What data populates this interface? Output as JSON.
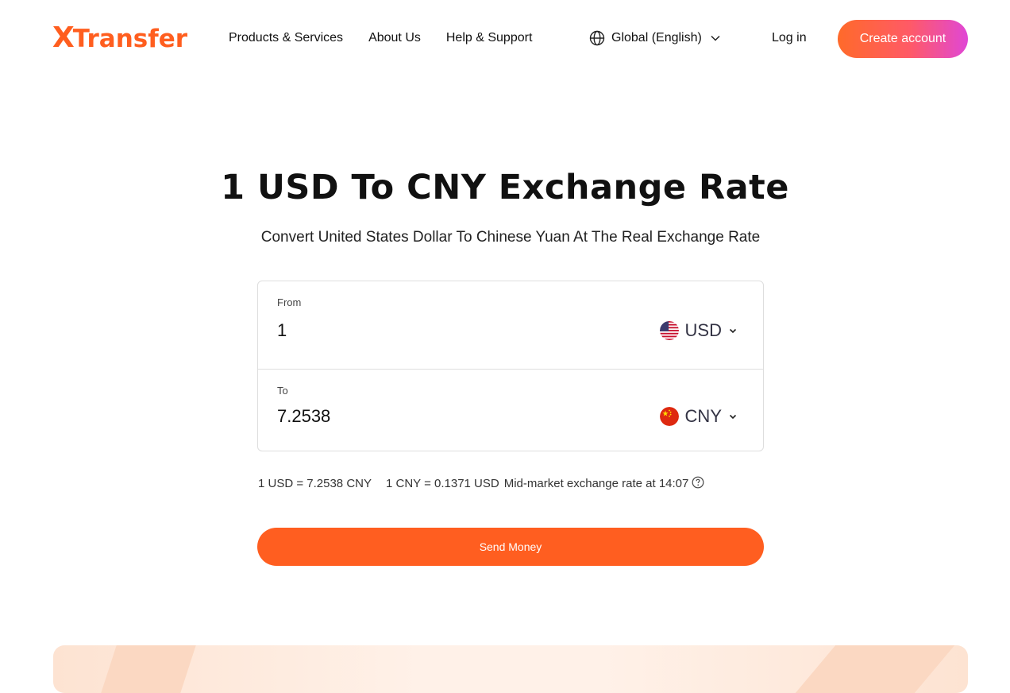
{
  "header": {
    "logo_text": "XTransfer",
    "nav": [
      {
        "label": "Products & Services"
      },
      {
        "label": "About Us"
      },
      {
        "label": "Help & Support"
      }
    ],
    "language_label": "Global (English)",
    "login_label": "Log in",
    "create_account_label": "Create account"
  },
  "hero": {
    "title": "1 USD To CNY Exchange Rate",
    "subtitle": "Convert United States Dollar To Chinese Yuan At The Real Exchange Rate"
  },
  "converter": {
    "from": {
      "label": "From",
      "amount": "1",
      "currency": "USD",
      "flag_icon": "us-flag-icon"
    },
    "to": {
      "label": "To",
      "amount": "7.2538",
      "currency": "CNY",
      "flag_icon": "cn-flag-icon"
    }
  },
  "rates": {
    "forward": "1 USD = 7.2538 CNY",
    "reverse": "1 CNY = 0.1371 USD",
    "note": "Mid-market exchange rate at 14:07"
  },
  "actions": {
    "send_money_label": "Send Money"
  },
  "colors": {
    "brand_orange": "#ff5e20",
    "gradient_end": "#e047d6"
  }
}
